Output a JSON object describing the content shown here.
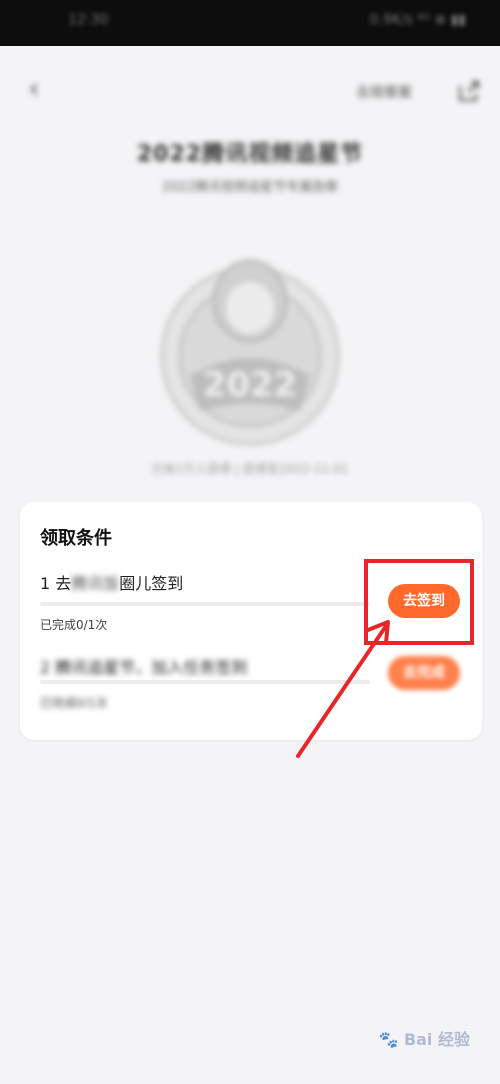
{
  "status_bar": {
    "time": "12:30",
    "icons": "0.9K/s ⁴ᴳ ⊕ ▮▮"
  },
  "nav": {
    "right_link": "去规章案"
  },
  "medal": {
    "title": "2022腾讯视频追星节",
    "subtitle": "2022腾讯视频追星节专属勋章",
    "date": "已有1万人获得 | 获得至2022-11-01"
  },
  "card": {
    "title": "领取条件",
    "tasks": [
      {
        "prefix": "1 去",
        "blurred": "腾讯饭",
        "suffix": "圈儿签到",
        "status": "已完成0/1次",
        "button": "去签到",
        "progress": 0
      },
      {
        "prefix": "2 腾讯追星节，加入任务签到",
        "blurred": "",
        "suffix": "",
        "status": "已完成0/1次",
        "button": "去完成",
        "progress": 0
      }
    ]
  },
  "annotation": {
    "color": "#e8252a"
  },
  "colors": {
    "accent": "#ff6a2c",
    "background": "#f4f4f6"
  },
  "watermark": {
    "text": "Bai  经验",
    "paw": "🐾"
  }
}
